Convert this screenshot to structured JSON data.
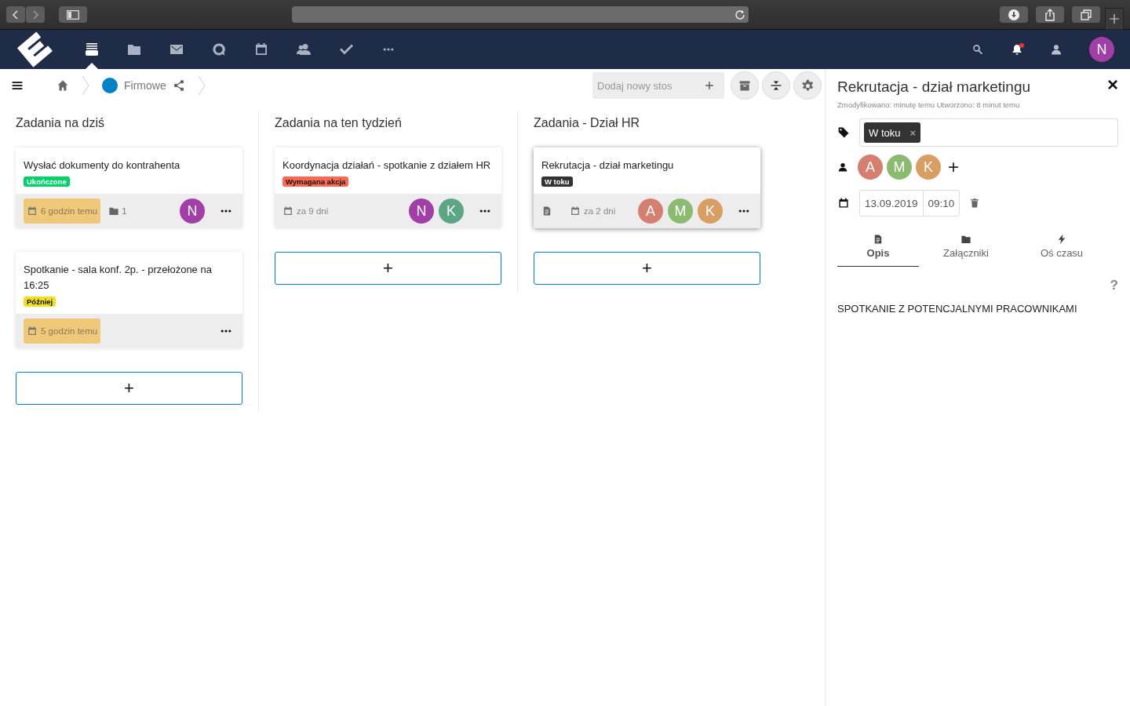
{
  "navbar": {
    "apps": [
      {
        "kind": "stack",
        "selected": true
      },
      {
        "kind": "folder",
        "selected": false
      },
      {
        "kind": "mail",
        "selected": false
      },
      {
        "kind": "chat",
        "selected": false
      },
      {
        "kind": "calendar",
        "selected": false
      },
      {
        "kind": "contacts",
        "selected": false
      },
      {
        "kind": "check",
        "selected": false
      },
      {
        "kind": "more",
        "selected": false
      }
    ],
    "notifications_unread": true,
    "user": {
      "initial": "N",
      "color": "#a13ea8"
    }
  },
  "breadcrumb": {
    "board": "Firmowe",
    "color": "#0082c9"
  },
  "add_stack": {
    "placeholder": "Dodaj nowy stos"
  },
  "stacks": [
    {
      "title": "Zadania na dziś",
      "add_label": "+",
      "cards": [
        {
          "title": "Wysłać dokumenty do kontrahenta",
          "selected": false,
          "label": {
            "text": "Ukończone",
            "color": "#00d26a"
          },
          "due": {
            "text": "6 godzin temu",
            "overdue": true
          },
          "attachments": "1",
          "has_description": false,
          "assignees": [
            {
              "initial": "N",
              "color": "#a13ea8"
            }
          ]
        },
        {
          "title": "Spotkanie - sala konf. 2p. - przełożone na 16:25",
          "selected": false,
          "label": {
            "text": "Później",
            "color": "#f0e020"
          },
          "due": {
            "text": "5 godzin temu",
            "overdue": true
          },
          "has_description": false
        }
      ]
    },
    {
      "title": "Zadania na ten tydzień",
      "add_label": "+",
      "cards": [
        {
          "title": "Koordynacja działań - spotkanie z działem HR",
          "selected": false,
          "label": {
            "text": "Wymagana akcja",
            "color": "#fa6b55"
          },
          "due": {
            "text": "za 9 dni",
            "overdue": false
          },
          "has_description": false,
          "assignees": [
            {
              "initial": "N",
              "color": "#a13ea8"
            },
            {
              "initial": "K",
              "color": "#5aa685"
            }
          ]
        }
      ]
    },
    {
      "title": "Zadania - Dział HR",
      "add_label": "+",
      "cards": [
        {
          "title": "Rekrutacja - dział marketingu",
          "selected": true,
          "label": {
            "text": "W toku",
            "color": "#333333"
          },
          "due": {
            "text": "za 2 dni",
            "overdue": false
          },
          "has_description": true,
          "assignees": [
            {
              "initial": "A",
              "color": "#d47f70"
            },
            {
              "initial": "M",
              "color": "#8abb70"
            },
            {
              "initial": "K",
              "color": "#d89e62"
            }
          ]
        }
      ]
    }
  ],
  "detail": {
    "title": "Rekrutacja - dział marketingu",
    "meta": "Zmodyfikowano: minutę temu Utworzono: 8 minut temu",
    "close": "×",
    "tags": [
      {
        "text": "W toku",
        "color": "#333333",
        "remove": "×"
      }
    ],
    "assignees": [
      {
        "initial": "A",
        "color": "#d47f70"
      },
      {
        "initial": "M",
        "color": "#8abb70"
      },
      {
        "initial": "K",
        "color": "#d89e62"
      }
    ],
    "add_assignee": "+",
    "date": "13.09.2019",
    "time": "09:10",
    "tabs": [
      {
        "label": "Opis",
        "kind": "doc",
        "selected": true
      },
      {
        "label": "Załączniki",
        "kind": "folder",
        "selected": false
      },
      {
        "label": "Oś czasu",
        "kind": "bolt",
        "selected": false
      }
    ],
    "help": "?",
    "description": "SPOTKANIE Z POTENCJALNYMI PRACOWNIKAMI"
  }
}
